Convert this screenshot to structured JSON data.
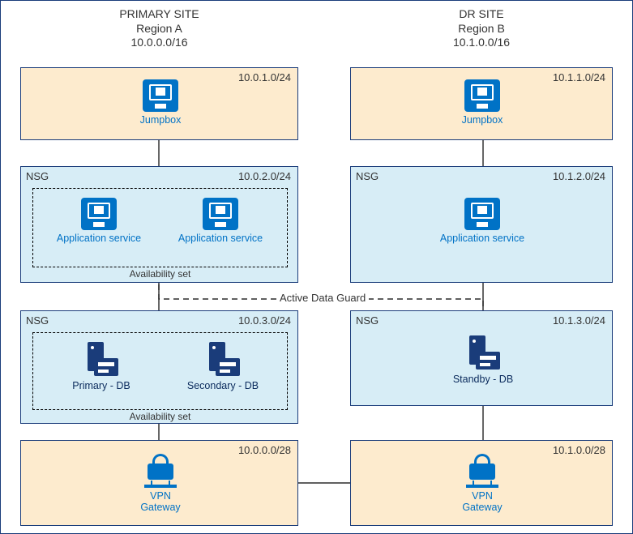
{
  "primary": {
    "title": "PRIMARY SITE",
    "region": "Region A",
    "cidr": "10.0.0.0/16",
    "subnets": {
      "jumpbox": {
        "cidr": "10.0.1.0/24",
        "label": "Jumpbox"
      },
      "app": {
        "nsg": "NSG",
        "cidr": "10.0.2.0/24",
        "label1": "Application service",
        "label2": "Application service",
        "avset": "Availability set"
      },
      "db": {
        "nsg": "NSG",
        "cidr": "10.0.3.0/24",
        "label1": "Primary - DB",
        "label2": "Secondary - DB",
        "avset": "Availability set"
      },
      "vpn": {
        "cidr": "10.0.0.0/28",
        "label1": "VPN",
        "label2": "Gateway"
      }
    }
  },
  "dr": {
    "title": "DR SITE",
    "region": "Region B",
    "cidr": "10.1.0.0/16",
    "subnets": {
      "jumpbox": {
        "cidr": "10.1.1.0/24",
        "label": "Jumpbox"
      },
      "app": {
        "nsg": "NSG",
        "cidr": "10.1.2.0/24",
        "label": "Application service"
      },
      "db": {
        "nsg": "NSG",
        "cidr": "10.1.3.0/24",
        "label": "Standby - DB"
      },
      "vpn": {
        "cidr": "10.1.0.0/28",
        "label1": "VPN",
        "label2": "Gateway"
      }
    }
  },
  "link_label": "Active Data Guard"
}
